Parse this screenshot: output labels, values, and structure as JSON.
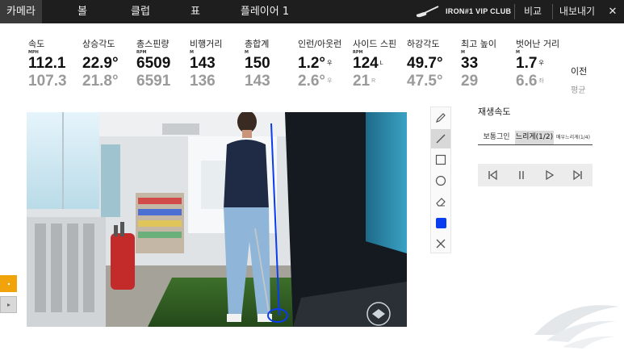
{
  "nav": {
    "tabs": [
      {
        "label": "카메라"
      },
      {
        "label": "볼"
      },
      {
        "label": "클럽"
      },
      {
        "label": "표"
      },
      {
        "label": "플레이어 1"
      }
    ],
    "brand": "IRON#1 VIP CLUB",
    "compare_label": "비교",
    "export_label": "내보내기",
    "close_label": "✕"
  },
  "stats": [
    {
      "label": "속도",
      "unit": "MPH",
      "current": "112.1",
      "avg": "107.3"
    },
    {
      "label": "상승각도",
      "unit": "",
      "current": "22.9°",
      "avg": "21.8°"
    },
    {
      "label": "총스핀량",
      "unit": "RPM",
      "current": "6509",
      "avg": "6591"
    },
    {
      "label": "비행거리",
      "unit": "M",
      "current": "143",
      "avg": "136"
    },
    {
      "label": "총합계",
      "unit": "M",
      "current": "150",
      "avg": "143"
    },
    {
      "label": "인런/아웃런",
      "unit": "",
      "current": "1.2°",
      "current_dir": "우",
      "avg": "2.6°",
      "avg_dir": "우"
    },
    {
      "label": "사이드 스핀",
      "unit": "RPM",
      "current": "124",
      "current_dir": "L",
      "avg": "21",
      "avg_dir": "R"
    },
    {
      "label": "하강각도",
      "unit": "",
      "current": "49.7°",
      "avg": "47.5°"
    },
    {
      "label": "최고 높이",
      "unit": "M",
      "current": "33",
      "avg": "29"
    },
    {
      "label": "벗어난 거리",
      "unit": "M",
      "current": "1.7",
      "current_dir": "우",
      "avg": "6.6",
      "avg_dir": "좌"
    }
  ],
  "row_labels": {
    "previous": "이전",
    "average": "평균"
  },
  "tools": [
    "pencil-icon",
    "line-icon",
    "rectangle-icon",
    "circle-icon",
    "eraser-icon",
    "color-swatch",
    "clear-icon"
  ],
  "accent_color": "#0a3cf0",
  "playback": {
    "title": "재생속도",
    "speeds": [
      {
        "label": "보통그인",
        "active": false
      },
      {
        "label": "느리게(1/2)",
        "active": true
      },
      {
        "label": "매우느리게(1/4)",
        "active": false
      }
    ],
    "controls": [
      "skip-back-icon",
      "pause-icon",
      "play-icon",
      "skip-forward-icon"
    ]
  }
}
